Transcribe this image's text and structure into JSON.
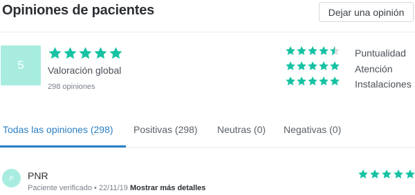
{
  "header": {
    "title": "Opiniones de pacientes",
    "review_button": "Dejar una opinión"
  },
  "summary": {
    "score": "5",
    "rating": 5,
    "label": "Valoración global",
    "count": "298 opiniones"
  },
  "categories": [
    {
      "label": "Puntualidad",
      "rating": 4.5
    },
    {
      "label": "Atención",
      "rating": 5
    },
    {
      "label": "Instalaciones",
      "rating": 5
    }
  ],
  "tabs": [
    {
      "label": "Todas las opiniones (298)",
      "active": true
    },
    {
      "label": "Positivas (298)",
      "active": false
    },
    {
      "label": "Neutras (0)",
      "active": false
    },
    {
      "label": "Negativas (0)",
      "active": false
    }
  ],
  "review": {
    "avatar_initial": "P",
    "name": "PNR",
    "meta": "Paciente verificado • 22/11/19",
    "details_link": "Mostrar más detalles",
    "rating": 5
  },
  "colors": {
    "star": "#16c2a3",
    "star_empty": "#d6dadd",
    "accent": "#2a7fc4",
    "score_box": "#a8ece0"
  },
  "icons": [
    "star-icon",
    "half-star-icon"
  ]
}
